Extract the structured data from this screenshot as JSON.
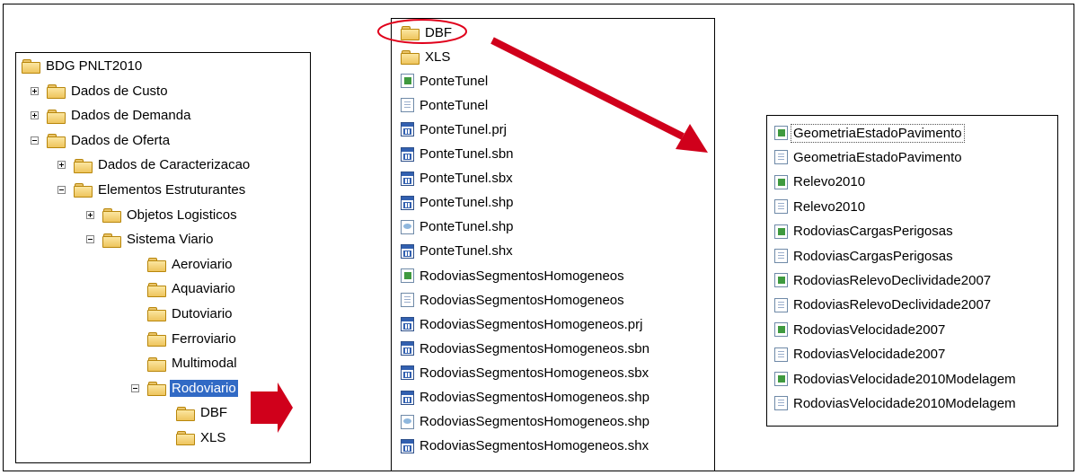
{
  "tree": [
    {
      "label": "BDG PNLT2010",
      "indent": 0,
      "exp": "none"
    },
    {
      "label": "Dados de Custo",
      "indent": 1,
      "exp": "plus"
    },
    {
      "label": "Dados de Demanda",
      "indent": 1,
      "exp": "plus"
    },
    {
      "label": "Dados de Oferta",
      "indent": 1,
      "exp": "minus"
    },
    {
      "label": "Dados de Caracterizacao",
      "indent": 2,
      "exp": "plus"
    },
    {
      "label": "Elementos Estruturantes",
      "indent": 2,
      "exp": "minus"
    },
    {
      "label": "Objetos Logisticos",
      "indent": 3,
      "exp": "plus"
    },
    {
      "label": "Sistema Viario",
      "indent": 3,
      "exp": "minus"
    },
    {
      "label": "Aeroviario",
      "indent": 4,
      "exp": "none"
    },
    {
      "label": "Aquaviario",
      "indent": 4,
      "exp": "none"
    },
    {
      "label": "Dutoviario",
      "indent": 4,
      "exp": "none"
    },
    {
      "label": "Ferroviario",
      "indent": 4,
      "exp": "none"
    },
    {
      "label": "Multimodal",
      "indent": 4,
      "exp": "none"
    },
    {
      "label": "Rodoviario",
      "indent": 4,
      "exp": "minus",
      "selected": true
    },
    {
      "label": "DBF",
      "indent": 5,
      "exp": "none"
    },
    {
      "label": "XLS",
      "indent": 5,
      "exp": "none"
    }
  ],
  "files": [
    {
      "label": "DBF",
      "icon": "folder"
    },
    {
      "label": "XLS",
      "icon": "folder"
    },
    {
      "label": "PonteTunel",
      "icon": "excel"
    },
    {
      "label": "PonteTunel",
      "icon": "doc"
    },
    {
      "label": "PonteTunel.prj",
      "icon": "data"
    },
    {
      "label": "PonteTunel.sbn",
      "icon": "data"
    },
    {
      "label": "PonteTunel.sbx",
      "icon": "data"
    },
    {
      "label": "PonteTunel.shp",
      "icon": "data"
    },
    {
      "label": "PonteTunel.shp",
      "icon": "xmlf"
    },
    {
      "label": "PonteTunel.shx",
      "icon": "data"
    },
    {
      "label": "RodoviasSegmentosHomogeneos",
      "icon": "excel"
    },
    {
      "label": "RodoviasSegmentosHomogeneos",
      "icon": "doc"
    },
    {
      "label": "RodoviasSegmentosHomogeneos.prj",
      "icon": "data"
    },
    {
      "label": "RodoviasSegmentosHomogeneos.sbn",
      "icon": "data"
    },
    {
      "label": "RodoviasSegmentosHomogeneos.sbx",
      "icon": "data"
    },
    {
      "label": "RodoviasSegmentosHomogeneos.shp",
      "icon": "data"
    },
    {
      "label": "RodoviasSegmentosHomogeneos.shp",
      "icon": "xmlf"
    },
    {
      "label": "RodoviasSegmentosHomogeneos.shx",
      "icon": "data"
    }
  ],
  "outputs": [
    {
      "label": "GeometriaEstadoPavimento",
      "icon": "excel",
      "focus": true
    },
    {
      "label": "GeometriaEstadoPavimento",
      "icon": "doc"
    },
    {
      "label": "Relevo2010",
      "icon": "excel"
    },
    {
      "label": "Relevo2010",
      "icon": "doc"
    },
    {
      "label": "RodoviasCargasPerigosas",
      "icon": "excel"
    },
    {
      "label": "RodoviasCargasPerigosas",
      "icon": "doc"
    },
    {
      "label": "RodoviasRelevoDeclividade2007",
      "icon": "excel"
    },
    {
      "label": "RodoviasRelevoDeclividade2007",
      "icon": "doc"
    },
    {
      "label": "RodoviasVelocidade2007",
      "icon": "excel"
    },
    {
      "label": "RodoviasVelocidade2007",
      "icon": "doc"
    },
    {
      "label": "RodoviasVelocidade2010Modelagem",
      "icon": "excel"
    },
    {
      "label": "RodoviasVelocidade2010Modelagem",
      "icon": "doc"
    }
  ],
  "colors": {
    "arrow": "#d0001b",
    "highlight": "#e0001b",
    "selection": "#316ac5"
  }
}
